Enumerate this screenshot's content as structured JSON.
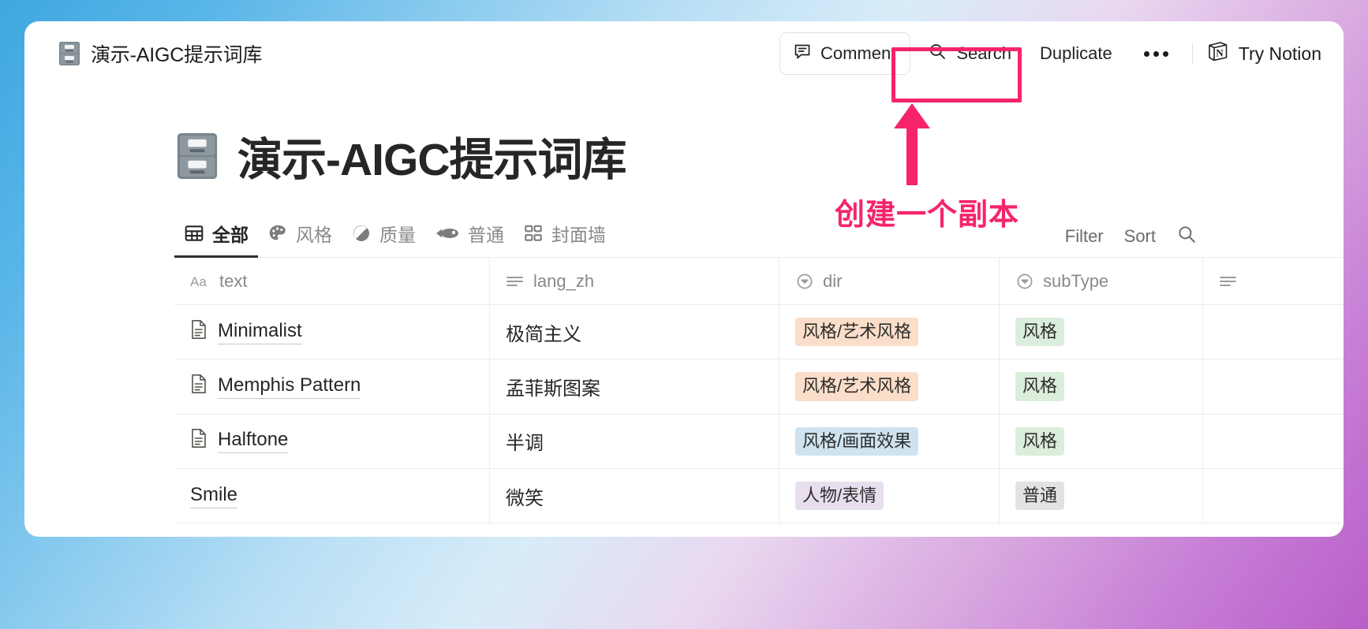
{
  "topbar": {
    "doc_title": "演示-AIGC提示词库",
    "doc_icon": "file-cabinet-emoji",
    "comment_label": "Comment",
    "comment_icon": "comment-icon",
    "search_label": "Search",
    "search_icon": "search-icon",
    "duplicate_label": "Duplicate",
    "more_icon": "ellipsis-icon",
    "try_notion_label": "Try Notion",
    "notion_logo_icon": "notion-cube-icon"
  },
  "annotation": {
    "text": "创建一个副本",
    "color": "#f6246c",
    "arrow_icon": "up-arrow-icon",
    "highlight_target": "Duplicate"
  },
  "page": {
    "title": "演示-AIGC提示词库",
    "title_icon": "file-cabinet-emoji"
  },
  "views": {
    "tabs": [
      {
        "label": "全部",
        "icon": "table-icon",
        "active": true
      },
      {
        "label": "风格",
        "icon": "palette-icon",
        "active": false
      },
      {
        "label": "质量",
        "icon": "contrast-circle-icon",
        "active": false
      },
      {
        "label": "普通",
        "icon": "fish-icon",
        "active": false
      },
      {
        "label": "封面墙",
        "icon": "gallery-icon",
        "active": false
      }
    ],
    "filter_label": "Filter",
    "sort_label": "Sort",
    "search_icon": "search-icon"
  },
  "table": {
    "columns": [
      {
        "label": "text",
        "icon": "title-aa-icon"
      },
      {
        "label": "lang_zh",
        "icon": "text-lines-icon"
      },
      {
        "label": "dir",
        "icon": "select-chevron-icon"
      },
      {
        "label": "subType",
        "icon": "select-chevron-icon"
      },
      {
        "label": "",
        "icon": "text-lines-icon"
      }
    ],
    "rows": [
      {
        "text": "Minimalist",
        "page_icon": "document-icon",
        "lang_zh": "极简主义",
        "dir": "风格/艺术风格",
        "dir_color": "orange",
        "subType": "风格",
        "subType_color": "green"
      },
      {
        "text": "Memphis Pattern",
        "page_icon": "document-icon",
        "lang_zh": "孟菲斯图案",
        "dir": "风格/艺术风格",
        "dir_color": "orange",
        "subType": "风格",
        "subType_color": "green"
      },
      {
        "text": "Halftone",
        "page_icon": "document-icon",
        "lang_zh": "半调",
        "dir": "风格/画面效果",
        "dir_color": "blue",
        "subType": "风格",
        "subType_color": "green"
      },
      {
        "text": "Smile",
        "page_icon": "",
        "lang_zh": "微笑",
        "dir": "人物/表情",
        "dir_color": "purple",
        "subType": "普通",
        "subType_color": "gray"
      }
    ]
  }
}
